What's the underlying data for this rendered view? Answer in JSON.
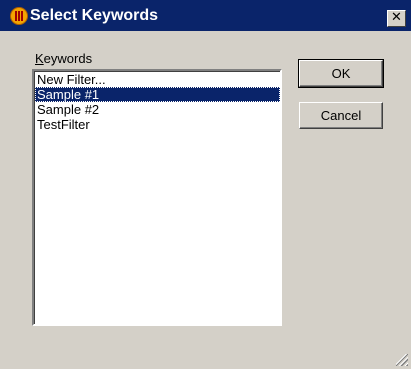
{
  "window": {
    "title": "Select Keywords",
    "close_glyph": "✕",
    "icon": "app-icon"
  },
  "keywords": {
    "label_mnemonic": "K",
    "label_rest": "eywords",
    "items": [
      "New Filter...",
      "Sample #1",
      "Sample #2",
      "TestFilter"
    ],
    "selected": "Sample #1"
  },
  "buttons": {
    "ok": "OK",
    "cancel": "Cancel"
  },
  "colors": {
    "titlebar": "#0a246a",
    "selection": "#0a246a",
    "dialog_bg": "#d4d0c8"
  }
}
